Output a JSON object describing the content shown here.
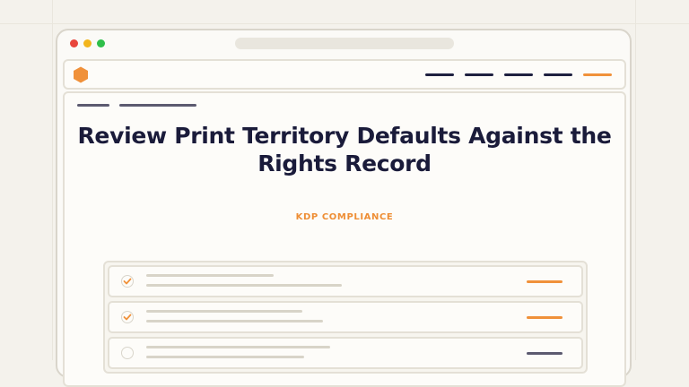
{
  "page": {
    "title": "Review Print Territory Defaults Against the Rights Record",
    "eyebrow": "KDP COMPLIANCE"
  },
  "colors": {
    "accent": "#f0913a",
    "navy": "#1e2040",
    "pending": "#5c5a70"
  },
  "icons": {
    "logo": "hexagon-logo-icon",
    "checked": "checkmark-icon"
  },
  "checklist": {
    "items": [
      {
        "checked": true,
        "status_color": "#f0913a"
      },
      {
        "checked": true,
        "status_color": "#f0913a"
      },
      {
        "checked": false,
        "status_color": "#5c5a70"
      }
    ]
  }
}
